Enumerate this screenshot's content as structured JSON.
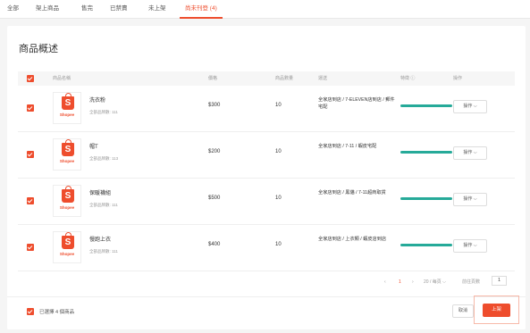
{
  "tabs": [
    {
      "label": "全部"
    },
    {
      "label": "架上商品"
    },
    {
      "label": "售完"
    },
    {
      "label": "已禁賣"
    },
    {
      "label": "未上架"
    },
    {
      "label": "尚未刊登 (4)"
    }
  ],
  "page_title": "商品概述",
  "table": {
    "headers": [
      "商品名稱",
      "價格",
      "商品數量",
      "運送",
      "特徵 ⓘ",
      "操作"
    ]
  },
  "products": [
    {
      "name": "洗衣粉",
      "meta": "全部品牌數: 111",
      "price": "$300",
      "qty": "10",
      "channel": "全家店到店 / 7-ELEVEN店到店 / 郵件宅配"
    },
    {
      "name": "帽T",
      "meta": "全部品牌數: 113",
      "price": "$200",
      "qty": "10",
      "channel": "全家店到店 / 7-11 / 蝦皮宅配"
    },
    {
      "name": "保暖襪組",
      "meta": "全部品牌數: 111",
      "price": "$500",
      "qty": "10",
      "channel": "全家店到店 / 黑貓 / 7-11超商取貨"
    },
    {
      "name": "慢跑上衣",
      "meta": "全部品牌數: 111",
      "price": "$400",
      "qty": "10",
      "channel": "全家店到店 / 上衣類 / 蝦皮店到店"
    }
  ],
  "product_image_label": "Shopee",
  "product_image_letter": "S",
  "action_label": "操作 ⌵",
  "pagination": {
    "prev": "‹",
    "current": "1",
    "next": "›",
    "page_size": "20 / 每頁 ⌵",
    "jump_label": "前往頁數",
    "jump_value": "1"
  },
  "footer": {
    "selected_text": "已選擇 4 個商品",
    "cancel_label": "取消",
    "publish_label": "上架"
  },
  "colors": {
    "accent": "#ee4d2d",
    "bar": "#26aa99"
  }
}
